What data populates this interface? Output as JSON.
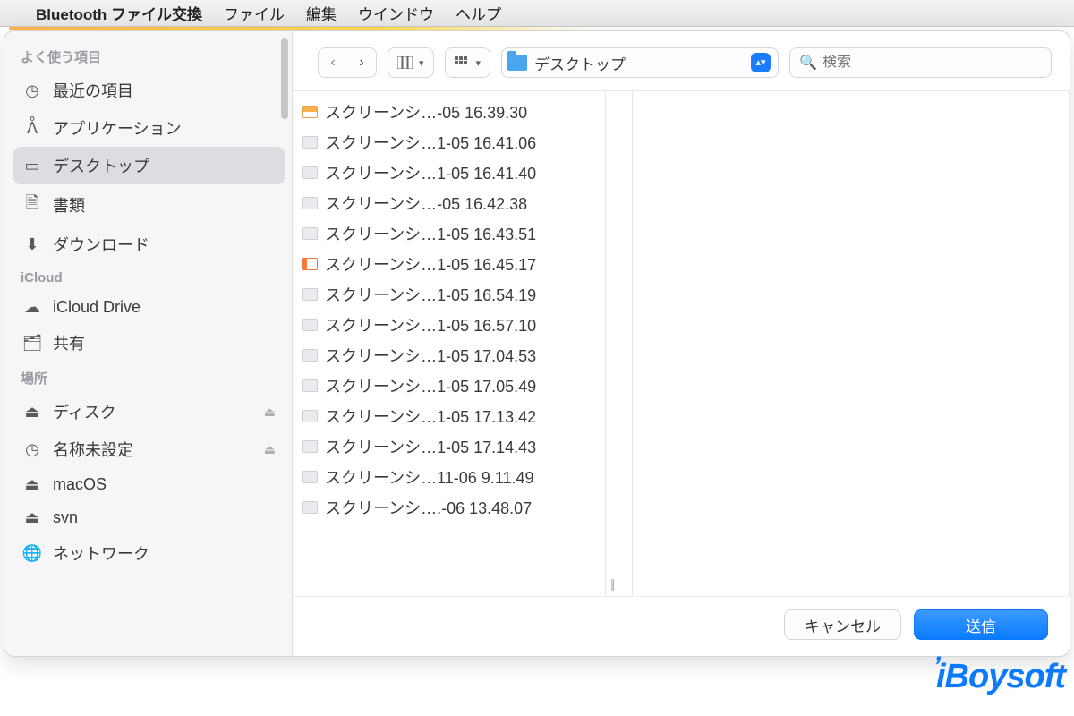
{
  "menubar": {
    "app_name": "Bluetooth ファイル交換",
    "items": [
      "ファイル",
      "編集",
      "ウインドウ",
      "ヘルプ"
    ]
  },
  "sidebar": {
    "sections": [
      {
        "title": "よく使う項目",
        "items": [
          {
            "icon": "clock",
            "label": "最近の項目"
          },
          {
            "icon": "app",
            "label": "アプリケーション"
          },
          {
            "icon": "desktop",
            "label": "デスクトップ",
            "selected": true
          },
          {
            "icon": "doc",
            "label": "書類"
          },
          {
            "icon": "download",
            "label": "ダウンロード"
          }
        ]
      },
      {
        "title": "iCloud",
        "items": [
          {
            "icon": "cloud",
            "label": "iCloud Drive"
          },
          {
            "icon": "shared",
            "label": "共有"
          }
        ]
      },
      {
        "title": "場所",
        "items": [
          {
            "icon": "disk",
            "label": "ディスク",
            "eject": true
          },
          {
            "icon": "clock",
            "label": "名称未設定",
            "eject": true
          },
          {
            "icon": "disk",
            "label": "macOS"
          },
          {
            "icon": "disk",
            "label": "svn"
          },
          {
            "icon": "globe",
            "label": "ネットワーク"
          }
        ]
      }
    ]
  },
  "toolbar": {
    "location_label": "デスクトップ",
    "search_placeholder": "検索"
  },
  "files": [
    {
      "thumb": "orange",
      "name": "スクリーンシ…-05 16.39.30"
    },
    {
      "thumb": "plain",
      "name": "スクリーンシ…1-05 16.41.06"
    },
    {
      "thumb": "plain",
      "name": "スクリーンシ…1-05 16.41.40"
    },
    {
      "thumb": "plain",
      "name": "スクリーンシ…-05 16.42.38"
    },
    {
      "thumb": "plain",
      "name": "スクリーンシ…1-05 16.43.51"
    },
    {
      "thumb": "orange2",
      "name": "スクリーンシ…1-05 16.45.17"
    },
    {
      "thumb": "plain",
      "name": "スクリーンシ…1-05 16.54.19"
    },
    {
      "thumb": "plain",
      "name": "スクリーンシ…1-05 16.57.10"
    },
    {
      "thumb": "plain",
      "name": "スクリーンシ…1-05 17.04.53"
    },
    {
      "thumb": "plain",
      "name": "スクリーンシ…1-05 17.05.49"
    },
    {
      "thumb": "plain",
      "name": "スクリーンシ…1-05 17.13.42"
    },
    {
      "thumb": "plain",
      "name": "スクリーンシ…1-05 17.14.43"
    },
    {
      "thumb": "plain",
      "name": "スクリーンシ…11-06 9.11.49"
    },
    {
      "thumb": "plain",
      "name": "スクリーンシ….-06 13.48.07"
    }
  ],
  "footer": {
    "cancel": "キャンセル",
    "send": "送信"
  },
  "watermark": "iBoysoft"
}
